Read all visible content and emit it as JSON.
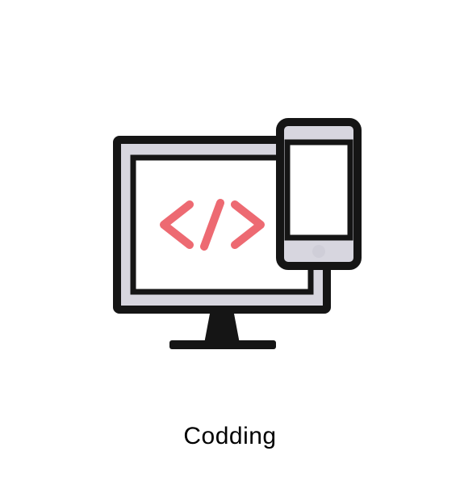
{
  "caption": "Codding",
  "colors": {
    "outline": "#151515",
    "bezel": "#d7d6df",
    "screen": "#ffffff",
    "code_symbol": "#ed6a72",
    "phone_button": "#cfced8"
  }
}
